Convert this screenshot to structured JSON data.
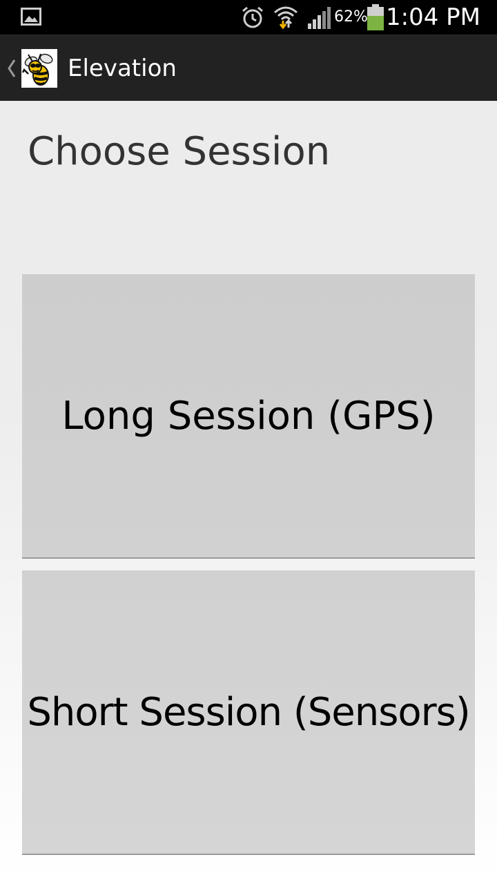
{
  "status_bar": {
    "icons": [
      "image-notification-icon",
      "alarm-icon",
      "wifi-icon",
      "signal-icon",
      "battery-icon"
    ],
    "battery_percent": "62%",
    "time": "1:04 PM",
    "battery_color": "#7cb342"
  },
  "action_bar": {
    "title": "Elevation",
    "icon": "yellow-jacket-logo",
    "up_icon": "chevron-left-icon"
  },
  "main": {
    "heading": "Choose Session",
    "buttons": [
      {
        "label": "Long Session (GPS)"
      },
      {
        "label": "Short Session (Sensors)"
      }
    ]
  }
}
